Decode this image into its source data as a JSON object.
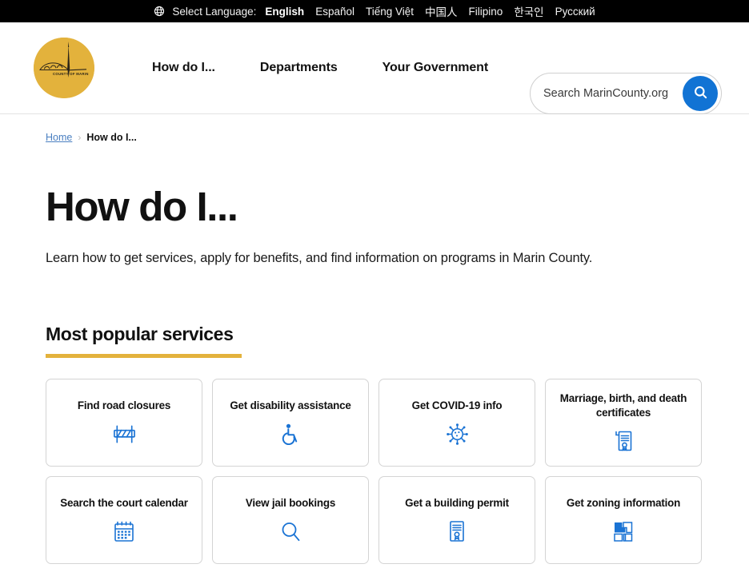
{
  "language_bar": {
    "globe_icon": "globe-icon",
    "select_label": "Select Language:",
    "languages": [
      {
        "label": "English",
        "active": true
      },
      {
        "label": "Español",
        "active": false
      },
      {
        "label": "Tiếng Việt",
        "active": false
      },
      {
        "label": "中国人",
        "active": false
      },
      {
        "label": "Filipino",
        "active": false
      },
      {
        "label": "한국인",
        "active": false
      },
      {
        "label": "Русский",
        "active": false
      }
    ]
  },
  "header": {
    "logo_text": "COUNTY OF MARIN",
    "logo_bg_color": "#e3b23c",
    "nav": [
      {
        "label": "How do I..."
      },
      {
        "label": "Departments"
      },
      {
        "label": "Your Government"
      }
    ],
    "search": {
      "placeholder": "Search MarinCounty.org",
      "value": "",
      "button_icon": "search-icon",
      "button_color": "#1173d4"
    }
  },
  "breadcrumb": {
    "home_label": "Home",
    "separator": "›",
    "current_label": "How do I..."
  },
  "page": {
    "title": "How do I...",
    "description": "Learn how to get services, apply for benefits, and find information on programs in Marin County."
  },
  "section": {
    "title": "Most popular services",
    "rule_color": "#e3b23c"
  },
  "cards": [
    {
      "label": "Find road closures",
      "icon": "road-barrier-icon"
    },
    {
      "label": "Get disability assistance",
      "icon": "wheelchair-icon"
    },
    {
      "label": "Get COVID-19 info",
      "icon": "virus-icon"
    },
    {
      "label": "Marriage, birth, and death certificates",
      "icon": "certificate-scroll-icon"
    },
    {
      "label": "Search the court calendar",
      "icon": "calendar-icon"
    },
    {
      "label": "View jail bookings",
      "icon": "magnifier-icon"
    },
    {
      "label": "Get a building permit",
      "icon": "permit-document-icon"
    },
    {
      "label": "Get zoning information",
      "icon": "zoning-parcels-icon"
    }
  ],
  "colors": {
    "accent_gold": "#e3b23c",
    "accent_blue": "#1173d4",
    "icon_blue": "#1a73d4",
    "text": "#111111",
    "card_border": "#d4d4d4"
  }
}
